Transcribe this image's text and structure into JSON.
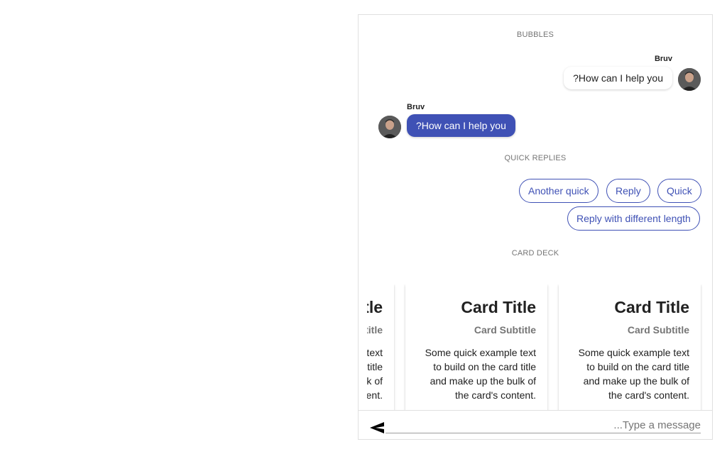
{
  "sections": {
    "bubbles": "BUBBLES",
    "quick_replies": "QUICK REPLIES",
    "card_deck": "CARD DECK"
  },
  "messages": [
    {
      "author": "Bruv",
      "text": "?How can I help you",
      "side": "right",
      "style": "light"
    },
    {
      "author": "Bruv",
      "text": "?How can I help you",
      "side": "left",
      "style": "accent"
    }
  ],
  "quick_replies": [
    "Another quick",
    "Reply",
    "Quick",
    "Reply with different length"
  ],
  "cards": [
    {
      "title": "Card Title",
      "subtitle": "Card Subtitle",
      "text": "Some quick example text to build on the card title and make up the bulk of the card's content."
    },
    {
      "title": "Card Title",
      "subtitle": "Card Subtitle",
      "text": "Some quick example text to build on the card title and make up the bulk of the card's content."
    },
    {
      "title": "Card Title",
      "subtitle": "Card Subtitle",
      "text": "Some quick example text to build on the card title and make up the bulk of the card's content."
    }
  ],
  "composer": {
    "placeholder": "...Type a message",
    "send_icon": "send-icon"
  },
  "colors": {
    "accent": "#3f51b5",
    "bubble_light": "#ffffff",
    "muted_text": "#757575"
  }
}
